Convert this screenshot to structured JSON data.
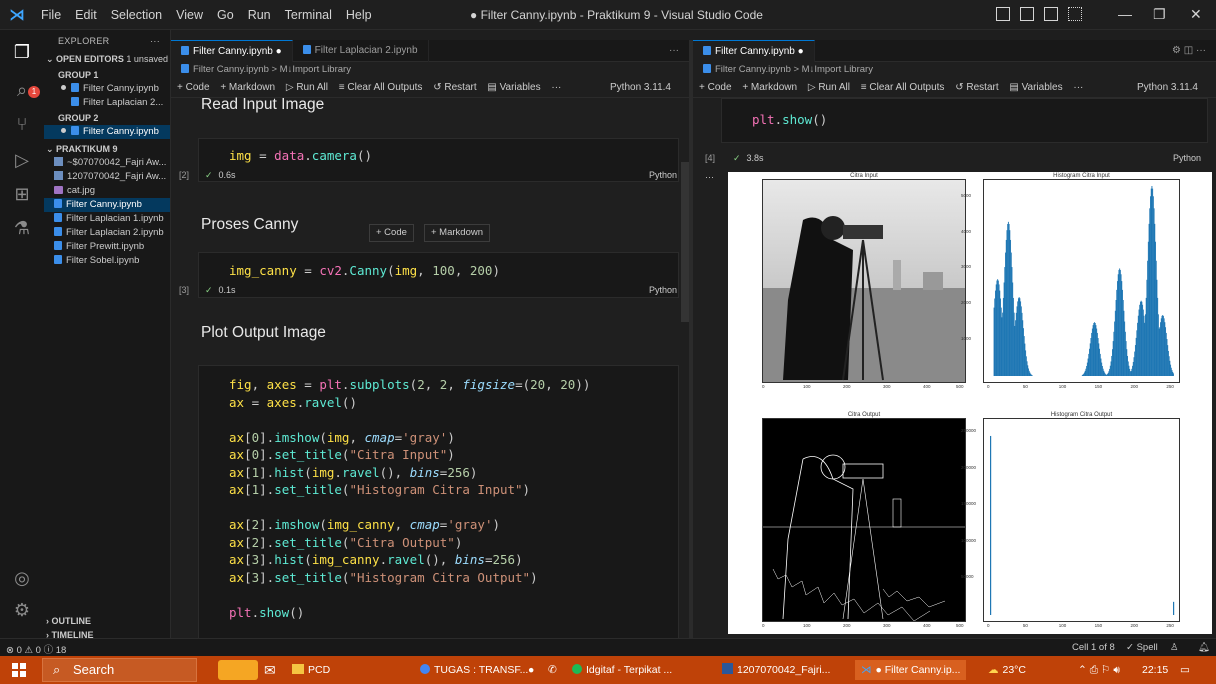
{
  "menu": [
    "File",
    "Edit",
    "Selection",
    "View",
    "Go",
    "Run",
    "Terminal",
    "Help"
  ],
  "window_title": "● Filter Canny.ipynb - Praktikum 9 - Visual Studio Code",
  "explorer": {
    "header": "EXPLORER",
    "open_editors": "OPEN EDITORS",
    "unsaved": "1 unsaved",
    "group1": "GROUP 1",
    "group1_files": [
      "Filter Canny.ipynb",
      "Filter Laplacian 2..."
    ],
    "group2": "GROUP 2",
    "group2_files": [
      "Filter Canny.ipynb"
    ],
    "folder": "PRAKTIKUM 9",
    "files": [
      "~$07070042_Fajri Aw...",
      "1207070042_Fajri Aw...",
      "cat.jpg",
      "Filter Canny.ipynb",
      "Filter Laplacian 1.ipynb",
      "Filter Laplacian 2.ipynb",
      "Filter Prewitt.ipynb",
      "Filter Sobel.ipynb"
    ],
    "outline": "OUTLINE",
    "timeline": "TIMELINE"
  },
  "group1": {
    "tabs": [
      "Filter Canny.ipynb ●",
      "Filter Laplacian 2.ipynb"
    ],
    "breadcrumb": "Filter Canny.ipynb > M↓Import Library",
    "toolbar": [
      "+ Code",
      "+ Markdown",
      "▷ Run All",
      "≡ Clear All Outputs",
      "↺ Restart",
      "▤ Variables",
      "···"
    ],
    "kernel": "Python 3.11.4",
    "md1": "Read Input Image",
    "cell1_code": "img = data.camera()",
    "cell1_count": "[2]",
    "cell1_time": "0.6s",
    "md2": "Proses Canny",
    "add_code": "+ Code",
    "add_markdown": "+ Markdown",
    "cell2_code": "img_canny = cv2.Canny(img, 100, 200)",
    "cell2_count": "[3]",
    "cell2_time": "0.1s",
    "md3": "Plot Output Image",
    "lang": "Python"
  },
  "group2": {
    "tab": "Filter Canny.ipynb ●",
    "breadcrumb": "Filter Canny.ipynb > M↓Import Library",
    "toolbar": [
      "+ Code",
      "+ Markdown",
      "▷ Run All",
      "≡ Clear All Outputs",
      "↺ Restart",
      "▤ Variables",
      "···"
    ],
    "kernel": "Python 3.11.4",
    "code_line": "plt.show()",
    "count": "[4]",
    "time": "3.8s",
    "lang": "Python",
    "dots": "···",
    "plot_titles": [
      "Citra Input",
      "Histogram Citra Input",
      "Citra Output",
      "Histogram Citra Output"
    ]
  },
  "chart_data": [
    {
      "type": "bar",
      "title": "Histogram Citra Input",
      "x": [
        0,
        50,
        100,
        150,
        200,
        250
      ],
      "y_ticks": [
        0,
        1000,
        2000,
        3000,
        4000,
        5000
      ],
      "xlim": [
        0,
        255
      ],
      "ylim": [
        0,
        5300
      ],
      "peaks": [
        {
          "x": 10,
          "y": 2700
        },
        {
          "x": 25,
          "y": 4300
        },
        {
          "x": 40,
          "y": 2200
        },
        {
          "x": 145,
          "y": 1500
        },
        {
          "x": 180,
          "y": 3000
        },
        {
          "x": 210,
          "y": 2100
        },
        {
          "x": 225,
          "y": 5300
        },
        {
          "x": 240,
          "y": 1700
        }
      ]
    },
    {
      "type": "bar",
      "title": "Histogram Citra Output",
      "x": [
        0,
        50,
        100,
        150,
        200,
        250
      ],
      "y_ticks": [
        0,
        50000,
        100000,
        150000,
        200000,
        250000
      ],
      "xlim": [
        0,
        255
      ],
      "ylim": [
        0,
        260000
      ],
      "bars": [
        {
          "x": 0,
          "y": 245000
        },
        {
          "x": 255,
          "y": 18000
        }
      ]
    }
  ],
  "statusbar": {
    "left": "⊗ 0 ⚠ 0 ⓘ 18",
    "cell": "Cell 1 of 8",
    "spell": "✓ Spell"
  },
  "taskbar": {
    "search": "Search",
    "items": [
      "PCD",
      "TUGAS : TRANSF...",
      "Idgitaf - Terpikat ...",
      "1207070042_Fajri...",
      "● Filter Canny.ip..."
    ],
    "weather": "23°C",
    "time": "22:15"
  }
}
